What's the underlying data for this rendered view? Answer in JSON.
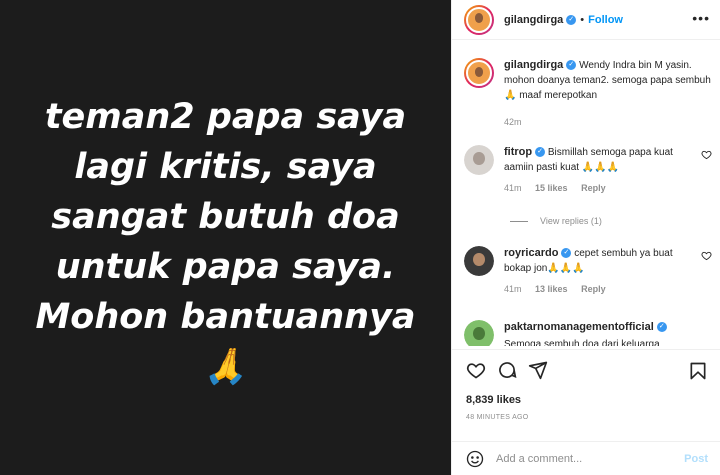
{
  "media": {
    "lines": [
      "teman2 papa saya",
      "lagi kritis, saya",
      "sangat butuh doa",
      "untuk papa saya.",
      "Mohon bantuannya🙏"
    ]
  },
  "header": {
    "username": "gilangdirga",
    "dot": "•",
    "follow_label": "Follow",
    "more_icon": "more-horizontal-icon"
  },
  "caption": {
    "username": "gilangdirga",
    "text": "Wendy Indra bin M yasin. mohon doanya teman2. semoga papa sembuh 🙏 maaf merepotkan",
    "time": "42m"
  },
  "comments": [
    {
      "username": "fitrop",
      "text": "Bismillah semoga papa kuat aamiin pasti kuat 🙏🙏🙏",
      "time": "41m",
      "likes": "15 likes",
      "reply": "Reply"
    },
    {
      "username": "royricardo",
      "text": "cepet sembuh ya buat bokap jon🙏🙏🙏",
      "time": "41m",
      "likes": "13 likes",
      "reply": "Reply"
    },
    {
      "username": "paktarnomanagementofficial",
      "text": "Semoga sembuh doa dari keluarga",
      "time": "",
      "likes": "",
      "reply": ""
    }
  ],
  "view_replies": "View replies (1)",
  "likes": "8,839 likes",
  "posted_time": "48 MINUTES AGO",
  "add_comment": {
    "placeholder": "Add a comment...",
    "post_label": "Post"
  },
  "colors": {
    "accent": "#0095f6",
    "verified": "#3897f0",
    "media_bg": "#1c1c1c"
  }
}
